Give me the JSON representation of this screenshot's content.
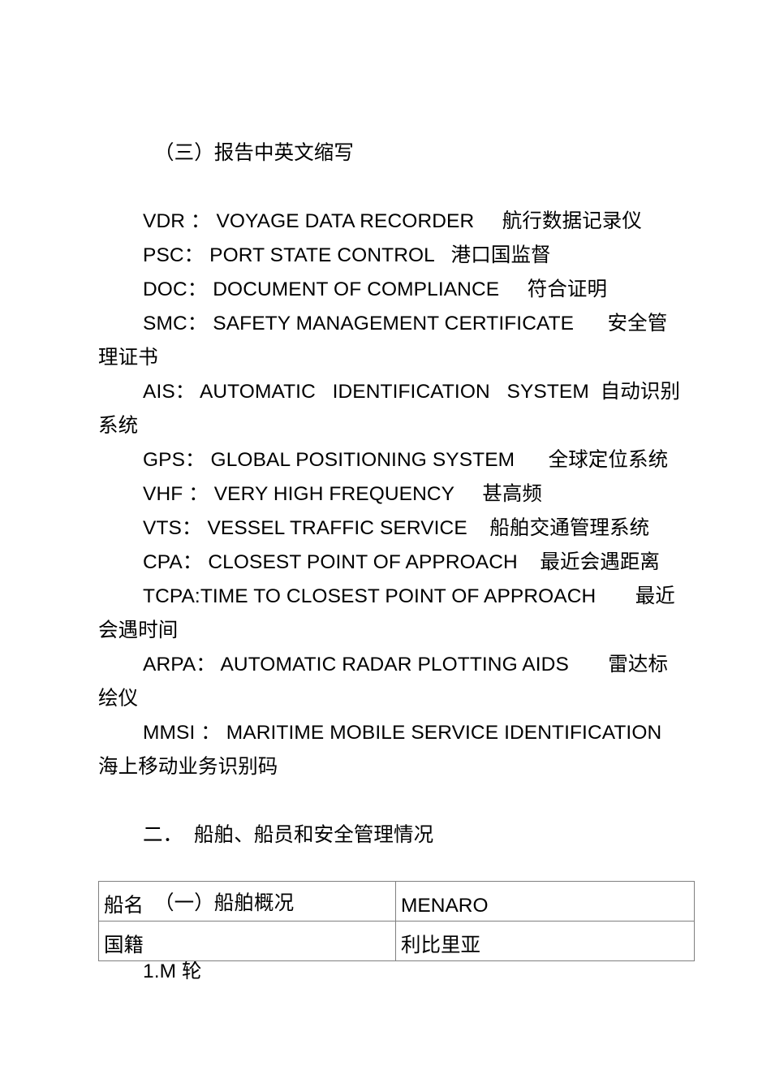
{
  "document": {
    "section_heading": "（三）报告中英文缩写",
    "abbreviations": [
      {
        "code": "VDR",
        "separator": "：",
        "english": "VOYAGE DATA RECORDER",
        "chinese": "航行数据记录仪",
        "line_text": "VDR ： VOYAGE DATA RECORDER     航行数据记录仪"
      },
      {
        "code": "PSC",
        "separator": "：",
        "english": "PORT STATE CONTROL",
        "chinese": "港口国监督",
        "line_text": "PSC： PORT STATE CONTROL   港口国监督"
      },
      {
        "code": "DOC",
        "separator": "：",
        "english": "DOCUMENT OF COMPLIANCE",
        "chinese": "符合证明",
        "line_text": "DOC： DOCUMENT OF COMPLIANCE     符合证明"
      },
      {
        "code": "SMC",
        "separator": "：",
        "english": "SAFETY MANAGEMENT CERTIFICATE",
        "chinese": "安全管理证书",
        "line_text": "SMC： SAFETY MANAGEMENT CERTIFICATE      安全管理证书"
      },
      {
        "code": "AIS",
        "separator": "：",
        "english": "AUTOMATIC   IDENTIFICATION   SYSTEM",
        "chinese": "自动识别系统",
        "line_text": "AIS： AUTOMATIC   IDENTIFICATION   SYSTEM  自动识别系统"
      },
      {
        "code": "GPS",
        "separator": "：",
        "english": "GLOBAL POSITIONING SYSTEM",
        "chinese": "全球定位系统",
        "line_text": "GPS： GLOBAL POSITIONING SYSTEM      全球定位系统"
      },
      {
        "code": "VHF",
        "separator": "：",
        "english": "VERY HIGH FREQUENCY",
        "chinese": "甚高频",
        "line_text": "VHF ： VERY HIGH FREQUENCY     甚高频"
      },
      {
        "code": "VTS",
        "separator": "：",
        "english": "VESSEL TRAFFIC SERVICE",
        "chinese": "船舶交通管理系统",
        "line_text": "VTS： VESSEL TRAFFIC SERVICE    船舶交通管理系统"
      },
      {
        "code": "CPA",
        "separator": "：",
        "english": "CLOSEST POINT OF APPROACH",
        "chinese": "最近会遇距离",
        "line_text": "CPA： CLOSEST POINT OF APPROACH    最近会遇距离"
      },
      {
        "code": "TCPA",
        "separator": ":",
        "english": "TIME TO CLOSEST POINT OF APPROACH",
        "chinese": "最近会遇时间",
        "line_text": "TCPA:TIME TO CLOSEST POINT OF APPROACH       最近会遇时间"
      },
      {
        "code": "ARPA",
        "separator": "：",
        "english": "AUTOMATIC RADAR PLOTTING AIDS",
        "chinese": "雷达标绘仪",
        "line_text": "ARPA： AUTOMATIC RADAR PLOTTING AIDS       雷达标绘仪"
      },
      {
        "code": "MMSI",
        "separator": "：",
        "english": "MARITIME MOBILE SERVICE IDENTIFICATION",
        "chinese": "海上移动业务识别码",
        "line_text": "MMSI ： MARITIME MOBILE SERVICE IDENTIFICATION 海上移动业务识别码"
      }
    ],
    "chapter_heading": "二．  船舶、船员和安全管理情况",
    "subsection_heading": "（一）船舶概况",
    "ship_label": "1.M 轮",
    "ship_table": {
      "rows": [
        {
          "label": "船名",
          "value": "MENARO"
        },
        {
          "label": "国籍",
          "value": "利比里亚"
        }
      ]
    }
  },
  "colors": {
    "page_background": "#ffffff",
    "text": "#000000",
    "table_border": "#808080"
  }
}
